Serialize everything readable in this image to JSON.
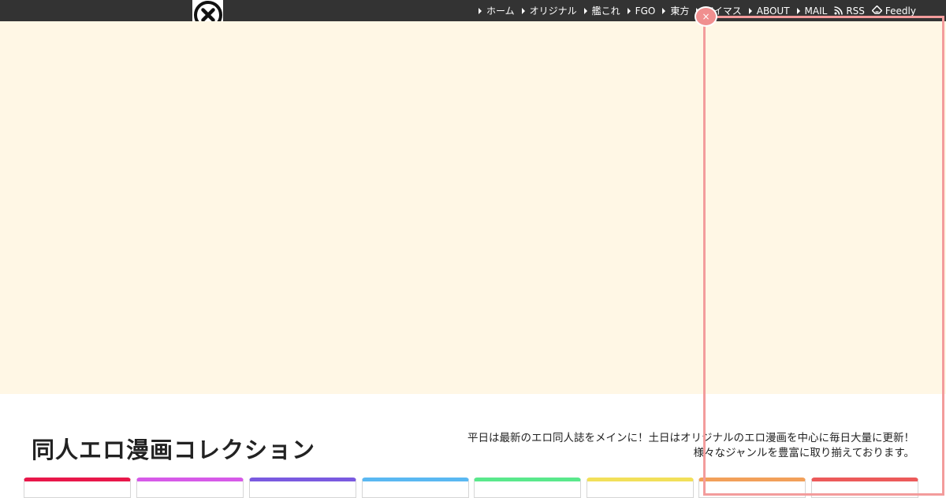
{
  "topbar": {
    "nav": [
      {
        "name": "nav-item-home",
        "label": "ホーム",
        "icon": "caret-right-icon"
      },
      {
        "name": "nav-item-original",
        "label": "オリジナル",
        "icon": "caret-right-icon"
      },
      {
        "name": "nav-item-kancolle",
        "label": "艦これ",
        "icon": "caret-right-icon"
      },
      {
        "name": "nav-item-fgo",
        "label": "FGO",
        "icon": "caret-right-icon"
      },
      {
        "name": "nav-item-touhou",
        "label": "東方",
        "icon": "caret-right-icon"
      },
      {
        "name": "nav-item-imas",
        "label": "アイマス",
        "icon": "caret-right-icon"
      },
      {
        "name": "nav-item-about",
        "label": "ABOUT",
        "icon": "caret-right-icon"
      },
      {
        "name": "nav-item-mail",
        "label": "MAIL",
        "icon": "caret-right-icon"
      },
      {
        "name": "nav-item-rss",
        "label": "RSS",
        "icon": "rss-icon"
      },
      {
        "name": "nav-item-feedly",
        "label": "Feedly",
        "icon": "feedly-icon"
      }
    ]
  },
  "header": {
    "site_title": "同人エロ漫画コレクション",
    "description": "平日は最新のエロ同人誌をメインに！土日はオリジナルのエロ漫画を中心に毎日大量に更新！様々なジャンルを豊富に取り揃えております。"
  },
  "categories": {
    "colors": [
      "#e8174a",
      "#d65ae8",
      "#7a5ae0",
      "#5ab8f2",
      "#5ae88c",
      "#f2e05a",
      "#f2a05a",
      "#ec5a5a"
    ]
  },
  "colors": {
    "topbar": "#333333",
    "banner": "#fff7e5",
    "overlay": "#f39c9c"
  }
}
